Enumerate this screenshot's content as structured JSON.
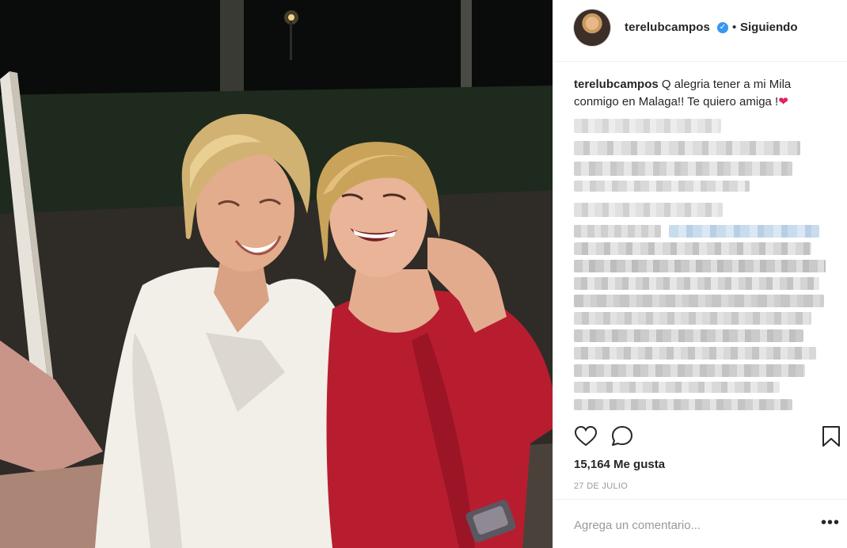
{
  "post": {
    "photo_alt": "",
    "author": {
      "username": "terelubcampos",
      "verified": true,
      "follow_status": "Siguiendo",
      "separator": "•"
    },
    "caption": {
      "username": "terelubcampos",
      "text": "Q alegria tener a mi Mila conmigo en Malaga!! Te quiero amiga !",
      "emoji": "❤"
    },
    "hidden_comments_note": "",
    "likes_text": "15,164 Me gusta",
    "date_text": "27 DE JULIO",
    "comment_placeholder": "Agrega un comentario...",
    "more_options": "•••",
    "icons": {
      "like": "heart-icon",
      "comment": "comment-bubble-icon",
      "save": "bookmark-icon",
      "verified": "verified-badge-icon",
      "more": "more-options-icon"
    }
  }
}
